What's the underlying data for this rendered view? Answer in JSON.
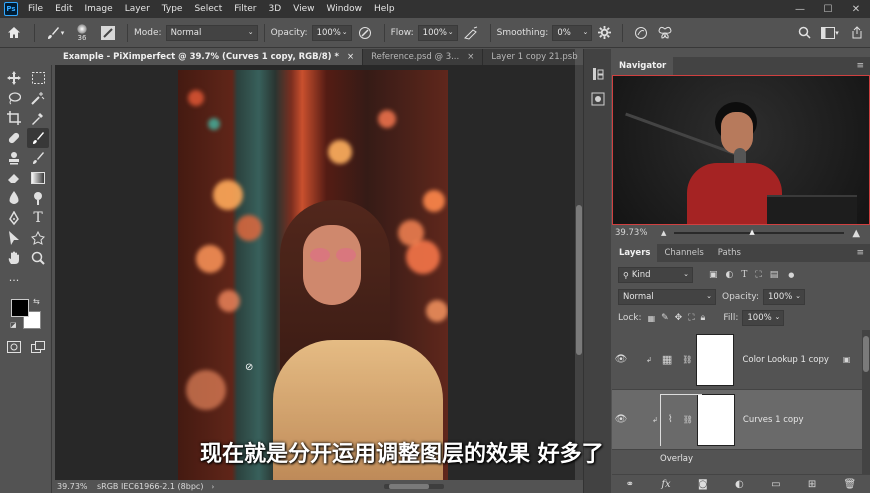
{
  "app": {
    "logo": "Ps"
  },
  "menu": [
    "File",
    "Edit",
    "Image",
    "Layer",
    "Type",
    "Select",
    "Filter",
    "3D",
    "View",
    "Window",
    "Help"
  ],
  "window_controls": {
    "minimize": "—",
    "maximize": "☐",
    "close": "✕"
  },
  "options": {
    "brush_size": "36",
    "mode_label": "Mode:",
    "mode_value": "Normal",
    "opacity_label": "Opacity:",
    "opacity_value": "100%",
    "flow_label": "Flow:",
    "flow_value": "100%",
    "smoothing_label": "Smoothing:",
    "smoothing_value": "0%"
  },
  "tabs": [
    {
      "label": "Example - PiXimperfect @ 39.7% (Curves 1 copy, RGB/8) *",
      "active": true
    },
    {
      "label": "Reference.psd @ 3...",
      "active": false
    },
    {
      "label": "Layer 1 copy 21.psb",
      "active": false
    }
  ],
  "tab_close": "×",
  "status": {
    "zoom": "39.73%",
    "profile": "sRGB IEC61966-2.1 (8bpc)"
  },
  "navigator": {
    "title": "Navigator",
    "zoom": "39.73%"
  },
  "layers_panel": {
    "tabs": [
      "Layers",
      "Channels",
      "Paths"
    ],
    "kind_label": "Kind",
    "blend_mode": "Normal",
    "opacity_label": "Opacity:",
    "opacity_value": "100%",
    "lock_label": "Lock:",
    "fill_label": "Fill:",
    "fill_value": "100%",
    "layers": [
      {
        "name": "Color Lookup 1 copy",
        "selected": false
      },
      {
        "name": "Curves 1 copy",
        "selected": true
      }
    ],
    "partial_layer": "Overlay"
  },
  "subtitle": "现在就是分开运用调整图层的效果 好多了",
  "colors": {
    "accent": "#31a8ff",
    "panel_bg": "#535353",
    "menubar": "#323232",
    "canvas_bg": "#282828"
  }
}
